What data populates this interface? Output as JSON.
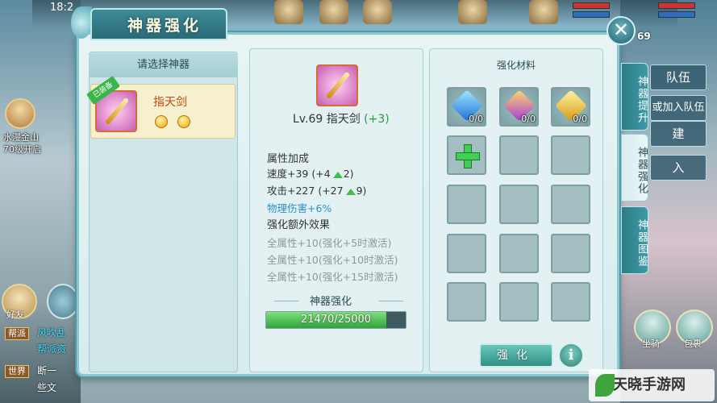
{
  "status": {
    "time": "18:2",
    "level": "69"
  },
  "left_side": {
    "avatar_name": "水漫金山",
    "avatar_sub": "70级开启",
    "friend_label": "好友",
    "chat": [
      {
        "tag": "帮派",
        "text": "风吹乱"
      },
      {
        "tag": "",
        "text": "帮派资"
      },
      {
        "tag": "世界",
        "text": "断一"
      },
      {
        "tag": "",
        "text": "些文"
      }
    ]
  },
  "right_side": {
    "team_label": "队伍",
    "join_team_label": "或加入队伍",
    "create_label": "建",
    "enter_label": "入",
    "bottom_left_label": "坐骑",
    "bottom_right_label": "包裹",
    "corner_label": "伙伴"
  },
  "modal": {
    "title": "神器强化",
    "close_icon": "close-icon",
    "left": {
      "header": "请选择神器",
      "badge": "已装备",
      "item_name": "指天剑"
    },
    "middle": {
      "weapon_level": "Lv.69 指天剑",
      "weapon_plus": "(+3)",
      "attr_title": "属性加成",
      "stats": [
        {
          "base": "速度+39",
          "inc": "(+4",
          "arrow": "2)"
        },
        {
          "base": "攻击+227",
          "inc": "(+27",
          "arrow": "9)"
        }
      ],
      "phys_damage": "物理伤害+6%",
      "extra_title": "强化额外效果",
      "extra_effects": [
        "全属性+10(强化+5时激活)",
        "全属性+10(强化+10时激活)",
        "全属性+10(强化+15时激活)"
      ],
      "progress_header": "神器强化",
      "progress_text": "21470/25000",
      "progress_ratio": 0.8588
    },
    "right": {
      "header": "强化材料",
      "materials": [
        {
          "icon": "blue-gem-icon",
          "count": "0/0"
        },
        {
          "icon": "purple-gem-icon",
          "count": "0/0"
        },
        {
          "icon": "gold-gem-icon",
          "count": "0/0"
        }
      ],
      "enhance_button": "强化",
      "info_button": "i"
    },
    "tabs": [
      {
        "label": "神器提升",
        "active": false
      },
      {
        "label": "神器强化",
        "active": true
      },
      {
        "label": "神器图鉴",
        "active": false
      }
    ]
  },
  "watermark": "天晓手游网"
}
